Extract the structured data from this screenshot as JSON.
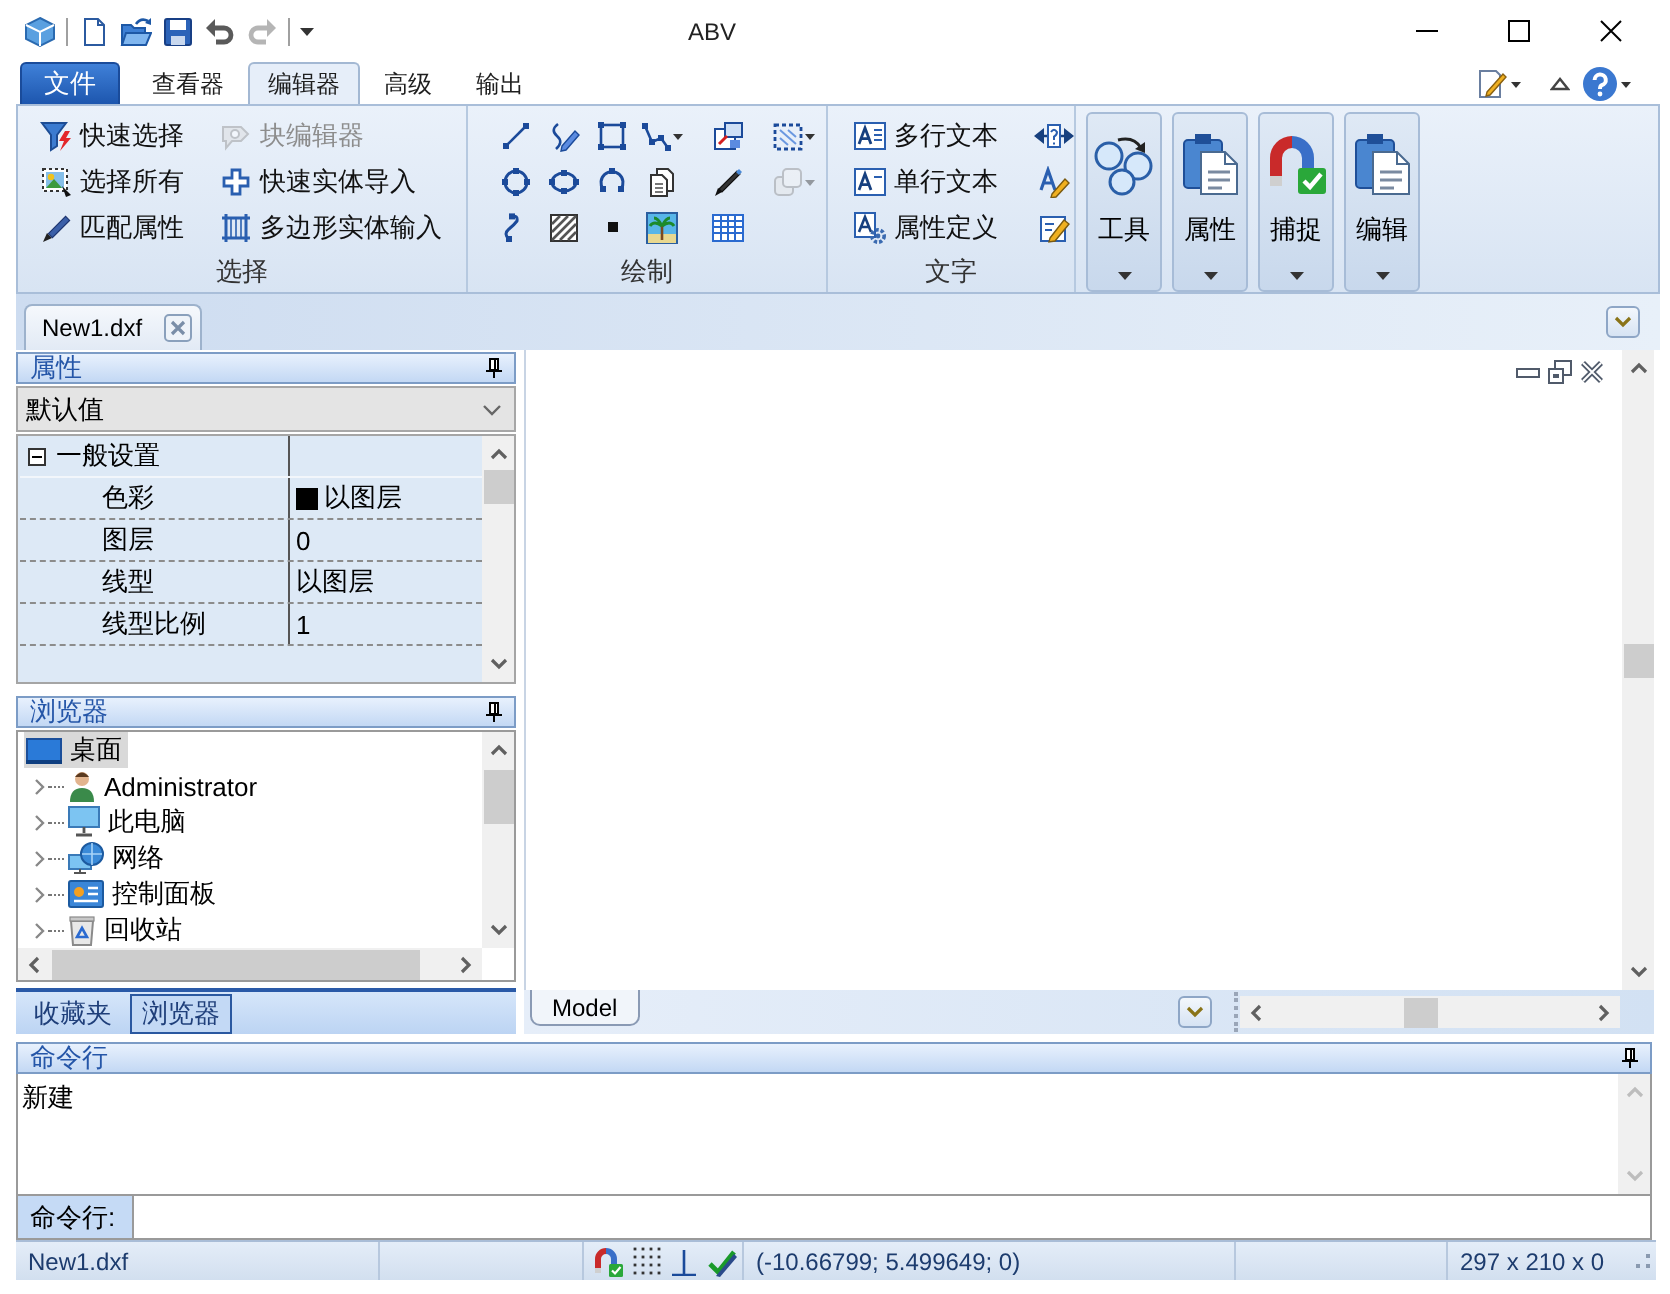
{
  "window": {
    "title": "ABV"
  },
  "quick_access": [
    {
      "disabled": false
    },
    {
      "disabled": false
    },
    {
      "disabled": false
    },
    {
      "disabled": false
    },
    {
      "disabled": true
    }
  ],
  "ribbon": {
    "file_menu": "文件",
    "tabs": [
      {
        "label": "查看器",
        "selected": false
      },
      {
        "label": "编辑器",
        "selected": true
      },
      {
        "label": "高级",
        "selected": false
      },
      {
        "label": "输出",
        "selected": false
      }
    ],
    "groups": [
      {
        "kind": "commands",
        "label": "选择",
        "columns": [
          [
            {
              "label": "快速选择",
              "disabled": false
            },
            {
              "label": "选择所有",
              "disabled": false
            },
            {
              "label": "匹配属性",
              "disabled": false
            }
          ],
          [
            {
              "label": "块编辑器",
              "disabled": true
            },
            {
              "label": "快速实体导入",
              "disabled": false
            },
            {
              "label": "多边形实体输入",
              "disabled": false
            }
          ]
        ]
      },
      {
        "kind": "tools",
        "label": "绘制",
        "tools": [
          {
            "disabled": false
          },
          {
            "disabled": false
          },
          {
            "disabled": false
          },
          {
            "disabled": false
          },
          {
            "disabled": false
          },
          {
            "disabled": false
          },
          {
            "disabled": false
          },
          {
            "disabled": false
          },
          {
            "disabled": false
          },
          {
            "disabled": false
          },
          {
            "disabled": false
          },
          {
            "disabled": true
          },
          {
            "disabled": false
          },
          {
            "disabled": false
          },
          {
            "disabled": false
          },
          {
            "disabled": false
          },
          {
            "disabled": false
          }
        ]
      },
      {
        "kind": "commands",
        "label": "文字",
        "columns": [
          [
            {
              "label": "多行文本",
              "disabled": false
            },
            {
              "label": "单行文本",
              "disabled": false
            },
            {
              "label": "属性定义",
              "disabled": false
            }
          ]
        ]
      }
    ],
    "large_buttons": [
      {
        "label": "工具"
      },
      {
        "label": "属性"
      },
      {
        "label": "捕捉"
      },
      {
        "label": "编辑"
      }
    ]
  },
  "document_tabs": [
    {
      "label": "New1.dxf",
      "selected": true
    }
  ],
  "properties_panel": {
    "title": "属性",
    "preset": "默认值",
    "categories": [
      {
        "label": "一般设置",
        "expanded": true,
        "rows": [
          {
            "name": "色彩",
            "value": "以图层",
            "color": "#000000"
          },
          {
            "name": "图层",
            "value": "0"
          },
          {
            "name": "线型",
            "value": "以图层"
          },
          {
            "name": "线型比例",
            "value": "1"
          }
        ]
      }
    ]
  },
  "browser_panel": {
    "title": "浏览器",
    "tree": [
      {
        "label": "桌面",
        "selected": true,
        "children": [
          {
            "label": "Administrator",
            "selected": false,
            "expanded": false
          },
          {
            "label": "此电脑",
            "selected": false,
            "expanded": false
          },
          {
            "label": "网络",
            "selected": false,
            "expanded": false
          },
          {
            "label": "控制面板",
            "selected": false,
            "expanded": false
          },
          {
            "label": "回收站",
            "selected": false,
            "expanded": false
          }
        ]
      }
    ]
  },
  "panel_tabs": [
    {
      "label": "收藏夹",
      "selected": false
    },
    {
      "label": "浏览器",
      "selected": true
    }
  ],
  "layout_tabs": [
    {
      "label": "Model",
      "selected": true
    }
  ],
  "command_panel": {
    "title": "命令行",
    "history": [
      "新建"
    ],
    "prompt": "命令行:"
  },
  "status_bar": {
    "file": "New1.dxf",
    "coordinates": "(-10.66799; 5.499649; 0)",
    "sheet_size": "297 x 210 x 0"
  }
}
